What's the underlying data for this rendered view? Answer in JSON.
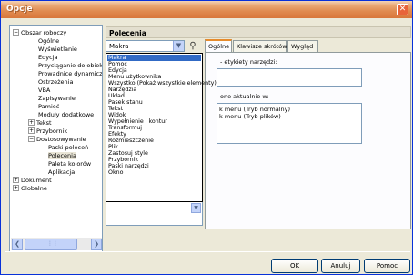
{
  "window": {
    "title": "Opcje",
    "close_glyph": "✕"
  },
  "tree": {
    "nodes": [
      {
        "label": "Obszar roboczy",
        "expander": "−"
      },
      {
        "label": "Ogólne"
      },
      {
        "label": "Wyświetlanie"
      },
      {
        "label": "Edycja"
      },
      {
        "label": "Przyciąganie do obiektów"
      },
      {
        "label": "Prowadnice dynamiczne"
      },
      {
        "label": "Ostrzeżenia"
      },
      {
        "label": "VBA"
      },
      {
        "label": "Zapisywanie"
      },
      {
        "label": "Pamięć"
      },
      {
        "label": "Moduły dodatkowe"
      },
      {
        "label": "Tekst",
        "expander": "+"
      },
      {
        "label": "Przybornik",
        "expander": "+"
      },
      {
        "label": "Dostosowywanie",
        "expander": "−"
      },
      {
        "label": "Paski poleceń"
      },
      {
        "label": "Polecenia"
      },
      {
        "label": "Paleta kolorów"
      },
      {
        "label": "Aplikacja"
      },
      {
        "label": "Dokument",
        "expander": "+"
      },
      {
        "label": "Globalne",
        "expander": "+"
      }
    ],
    "scroll_left": "❮",
    "scroll_right": "❯",
    "thumb_grip": "⋮⋮"
  },
  "panel": {
    "header": "Polecenia",
    "combo_value": "Makra",
    "combo_arrow": "▼",
    "find_glyph": "⚲",
    "dropdown_items": [
      "Makra",
      "Pomoc",
      "Edycja",
      "Menu użytkownika",
      "Wszystko (Pokaż wszystkie elementy)",
      "Narzędzia",
      "Układ",
      "Pasek stanu",
      "Tekst",
      "Widok",
      "Wypełnienie i kontur",
      "Transformuj",
      "Efekty",
      "Rozmieszczenie",
      "Plik",
      "Zastosuj style",
      "Przybornik",
      "Paski narzędzi",
      "Okno"
    ],
    "scroll_down": "▼",
    "tabs": [
      "Ogólne",
      "Klawisze skrótów",
      "Wygląd"
    ],
    "label_top": "- etykiety narzędzi:",
    "label_mid": "one aktualnie w:",
    "box_items": [
      "k menu (Tryb normalny)",
      "k menu (Tryb plików)"
    ]
  },
  "buttons": {
    "ok": "OK",
    "cancel": "Anuluj",
    "help": "Pomoc"
  }
}
